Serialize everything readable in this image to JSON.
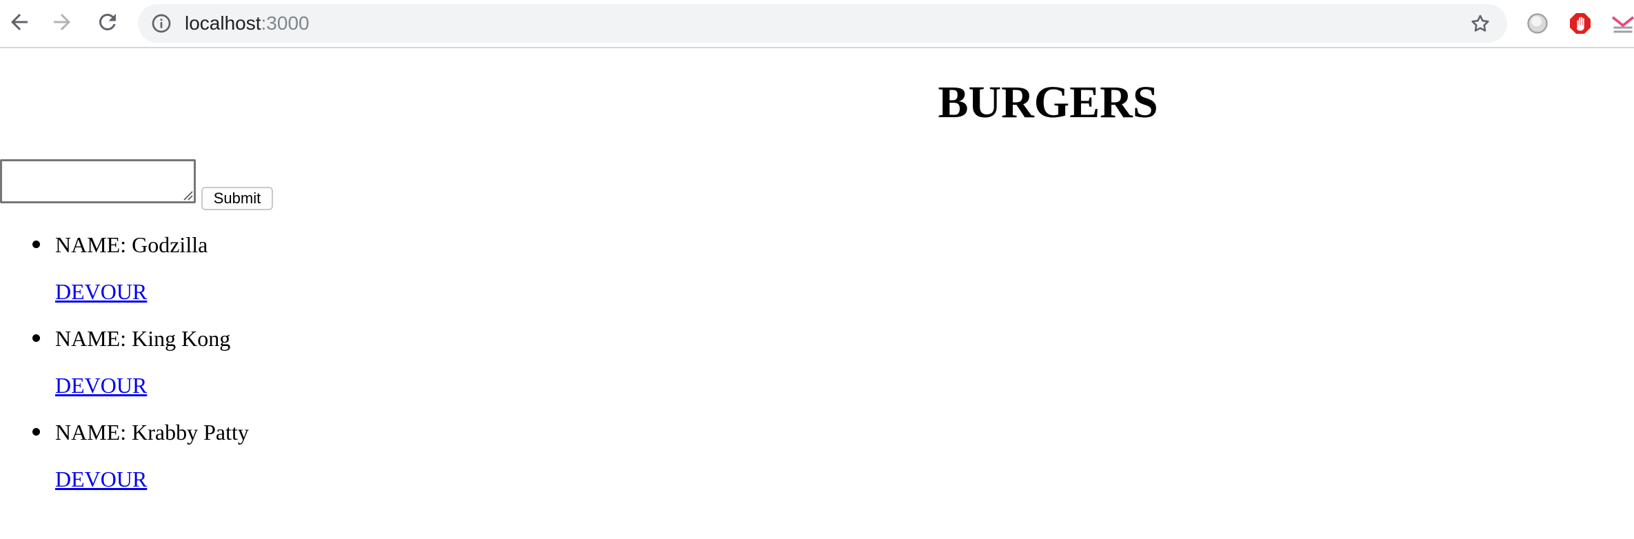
{
  "browser": {
    "url_host": "localhost",
    "url_port": ":3000",
    "icons": {
      "back": "arrow-left-icon",
      "forward": "arrow-right-icon",
      "reload": "reload-icon",
      "site_info": "info-icon",
      "bookmark": "star-icon",
      "extensions": [
        "gray-circle-extension-icon",
        "red-hand-extension-icon",
        "pink-extension-icon"
      ]
    }
  },
  "page": {
    "title": "BURGERS",
    "form": {
      "input_value": "",
      "submit_label": "Submit"
    },
    "burgers": [
      {
        "name": "NAME: Godzilla",
        "action": "DEVOUR"
      },
      {
        "name": "NAME: King Kong",
        "action": "DEVOUR"
      },
      {
        "name": "NAME: Krabby Patty",
        "action": "DEVOUR"
      }
    ]
  },
  "colors": {
    "link": "#0000ee",
    "omnibox": "#f1f3f4",
    "extension_red": "#e0201f",
    "extension_pink": "#e8497b"
  }
}
